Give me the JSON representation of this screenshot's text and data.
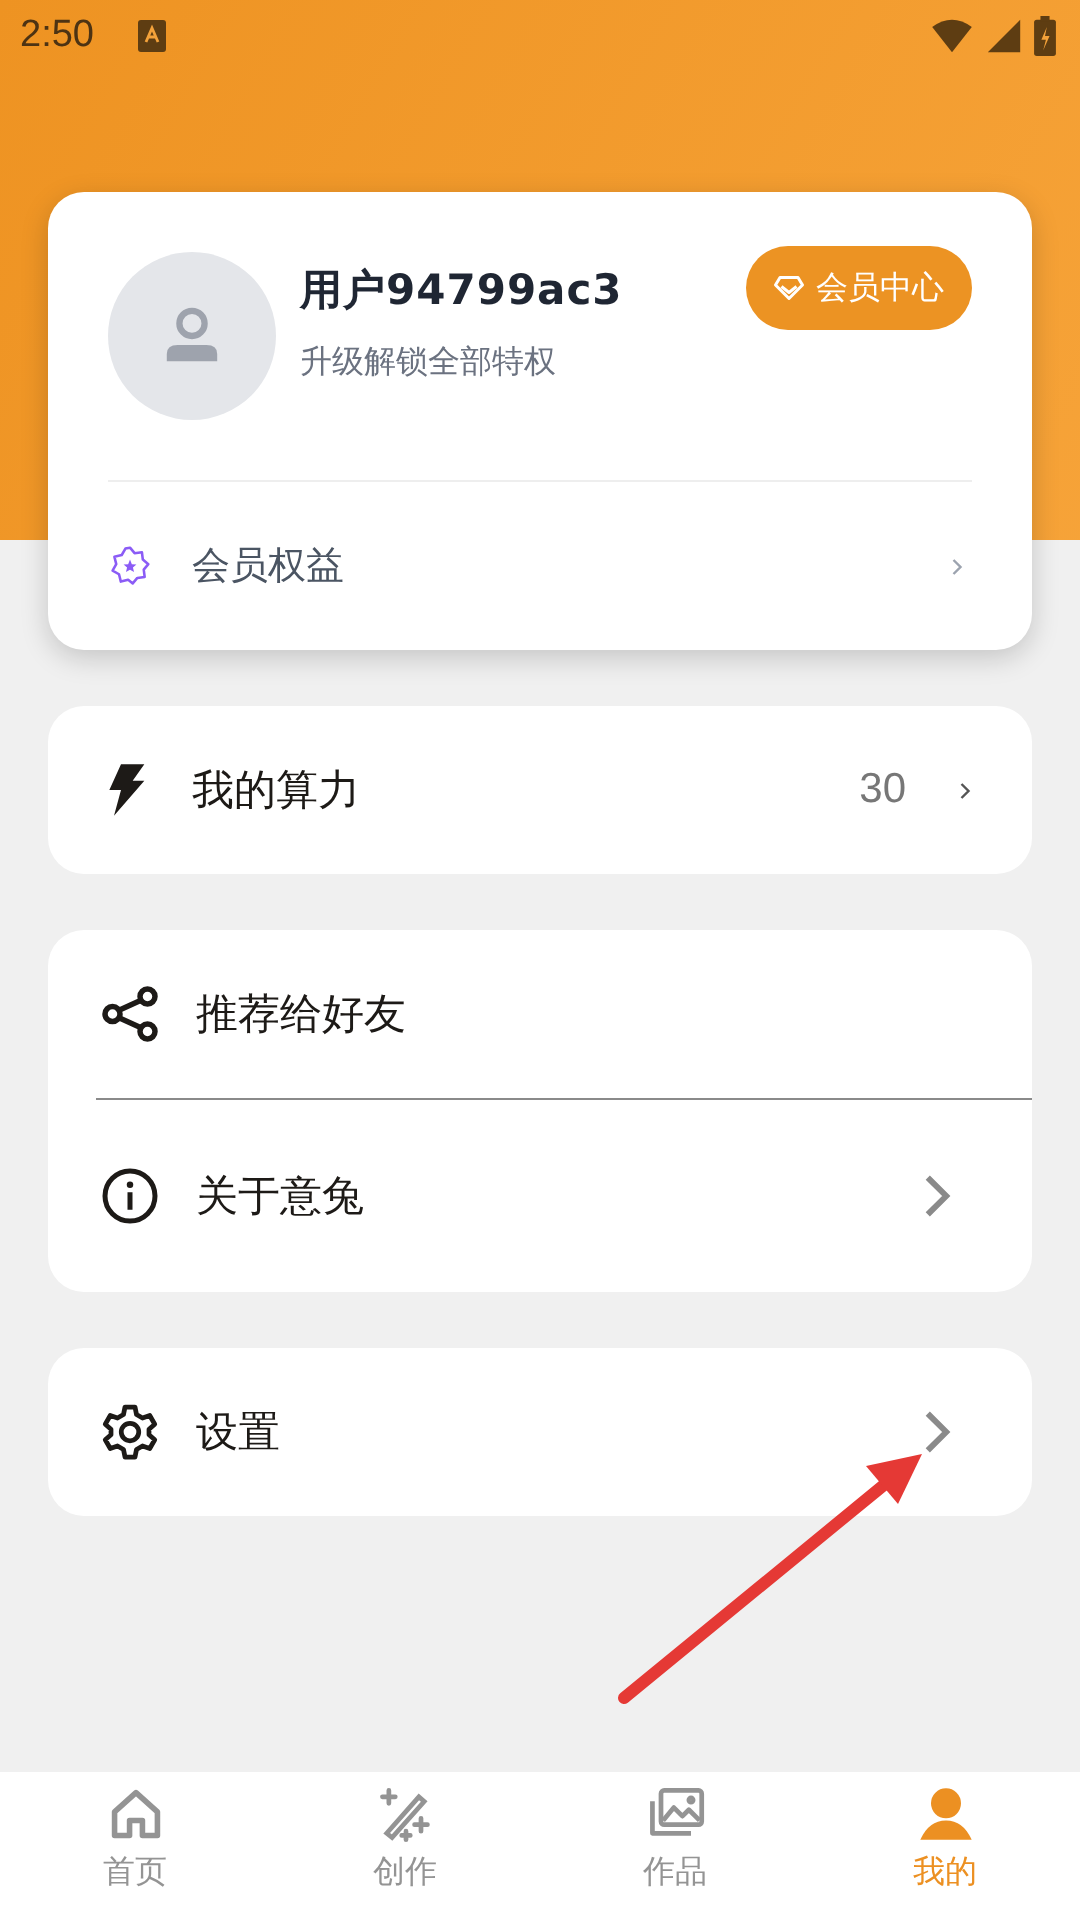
{
  "status_bar": {
    "time": "2:50"
  },
  "profile": {
    "username": "用户94799ac3",
    "subtitle": "升级解锁全部特权",
    "member_button": "会员中心",
    "benefits_row": {
      "label": "会员权益"
    }
  },
  "sections": [
    {
      "items": [
        {
          "kind": "compact",
          "label": "我的算力",
          "value": "30"
        }
      ]
    },
    {
      "items": [
        {
          "kind": "plain",
          "label": "推荐给好友"
        },
        {
          "kind": "link",
          "label": "关于意兔"
        }
      ]
    },
    {
      "items": [
        {
          "kind": "link",
          "label": "设置"
        }
      ]
    }
  ],
  "annotation": {
    "kind": "arrow"
  },
  "tabs": [
    {
      "label": "首页",
      "selected": false
    },
    {
      "label": "创作",
      "selected": false
    },
    {
      "label": "作品",
      "selected": false
    },
    {
      "label": "我的",
      "selected": true
    }
  ]
}
